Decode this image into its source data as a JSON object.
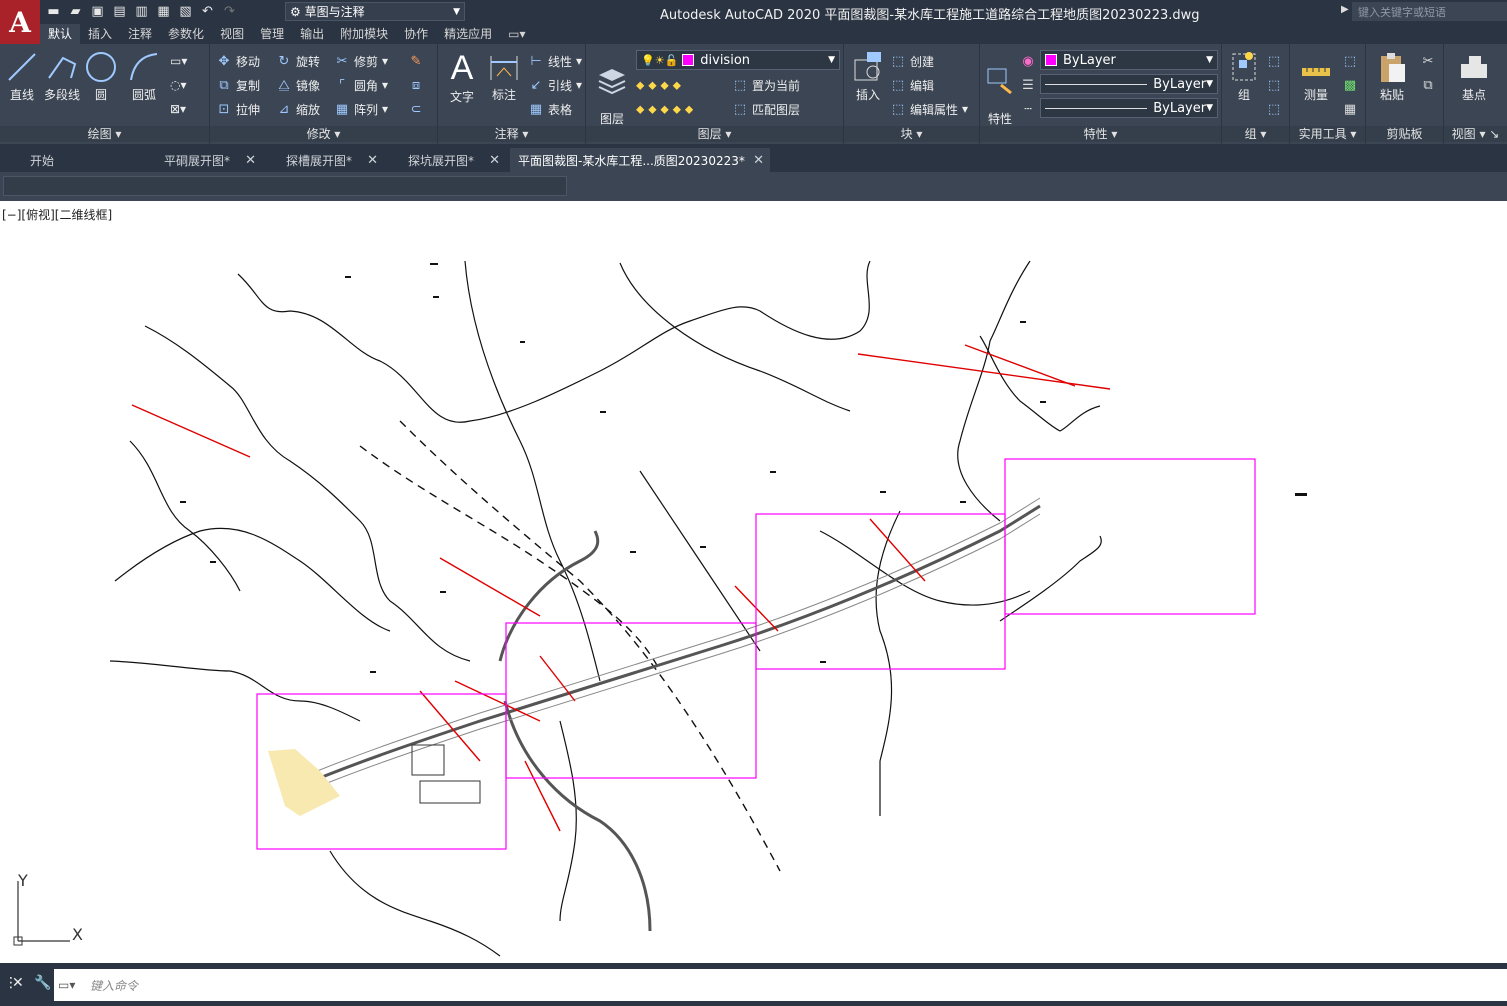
{
  "app": {
    "logo": "A",
    "title": "Autodesk AutoCAD 2020    平面图裁图-某水库工程施工道路综合工程地质图20230223.dwg",
    "workspace": "草图与注释",
    "search_placeholder": "键入关键字或短语"
  },
  "ribbon_tabs": [
    "默认",
    "插入",
    "注释",
    "参数化",
    "视图",
    "管理",
    "输出",
    "附加模块",
    "协作",
    "精选应用"
  ],
  "panels": {
    "draw": {
      "title": "绘图",
      "line": "直线",
      "polyline": "多段线",
      "circle": "圆",
      "arc": "圆弧"
    },
    "modify": {
      "title": "修改",
      "move": "移动",
      "rotate": "旋转",
      "trim": "修剪",
      "copy": "复制",
      "mirror": "镜像",
      "fillet": "圆角",
      "stretch": "拉伸",
      "scale": "缩放",
      "array": "阵列"
    },
    "annotation": {
      "title": "注释",
      "text": "文字",
      "dimension": "标注",
      "linear": "线性",
      "leader": "引线",
      "table": "表格"
    },
    "layers": {
      "title": "图层",
      "props": "图层\n特性",
      "layer_name": "division",
      "set_current": "置为当前",
      "match_layer": "匹配图层"
    },
    "block": {
      "title": "块",
      "insert": "插入",
      "create": "创建",
      "edit": "编辑",
      "edit_attr": "编辑属性"
    },
    "properties": {
      "title": "特性",
      "match": "特性\n匹配",
      "color": "ByLayer",
      "linetype": "ByLayer",
      "lineweight": "ByLayer"
    },
    "groups": {
      "title": "组",
      "group": "组"
    },
    "utilities": {
      "title": "实用工具",
      "measure": "测量"
    },
    "clipboard": {
      "title": "剪贴板",
      "paste": "粘贴"
    },
    "view": {
      "title": "视图",
      "base": "基点"
    }
  },
  "doc_tabs": [
    "开始",
    "平硐展开图*",
    "探槽展开图*",
    "探坑展开图*",
    "平面图裁图-某水库工程...质图20230223*"
  ],
  "viewport_label": "[−][俯视][二维线框]",
  "ucs": {
    "y": "Y",
    "x": "X"
  },
  "command": {
    "placeholder": "键入命令"
  },
  "colors": {
    "ribbon": "#3b4553",
    "title": "#2b3442",
    "accent_magenta": "#ff00ff",
    "logo_red": "#a9222a"
  }
}
